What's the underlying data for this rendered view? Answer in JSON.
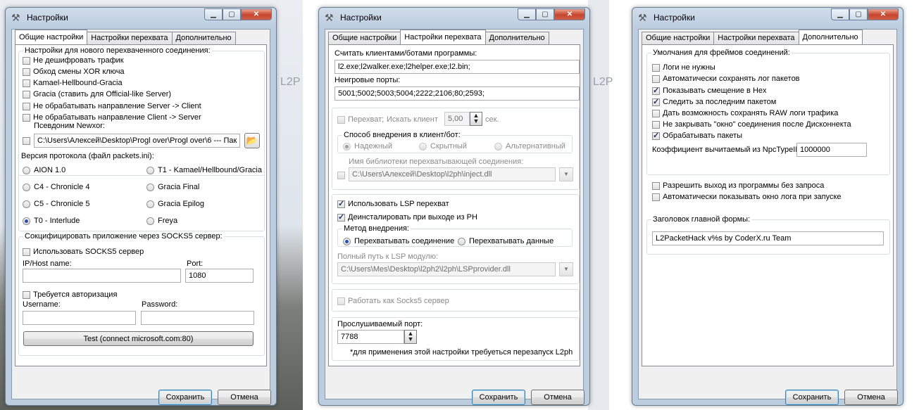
{
  "ghost_text": "L2P",
  "window_title": "Настройки",
  "tabs": [
    "Общие настройки",
    "Настройки перехвата",
    "Дополнительно"
  ],
  "buttons": {
    "save": "Сохранить",
    "cancel": "Отмена"
  },
  "general": {
    "new_conn_group": "Настройки для нового перехваченного соединения:",
    "checks": [
      {
        "label": "Не дешифровать трафик",
        "checked": false
      },
      {
        "label": "Обход смены XOR ключа",
        "checked": false
      },
      {
        "label": "Kamael-Hellbound-Gracia",
        "checked": false
      },
      {
        "label": "Gracia (ставить для Official-like Server)",
        "checked": false
      },
      {
        "label": "Не обрабатывать направление Server -> Client",
        "checked": false
      },
      {
        "label": "Не обрабатывать направление Client -> Server",
        "checked": false
      }
    ],
    "newxor_label": "Псевдоним Newxor:",
    "newxor_path": "C:\\Users\\Алексей\\Desktop\\Progl over\\Progl over\\6 --- Пак",
    "protocol_group": "Версия протокола (файл packets.ini):",
    "protocols": [
      {
        "label": "AION 1.0",
        "selected": false
      },
      {
        "label": "T1 - Kamael/Hellbound/Gracia",
        "selected": false
      },
      {
        "label": "C4 - Chronicle 4",
        "selected": false
      },
      {
        "label": "Gracia Final",
        "selected": false
      },
      {
        "label": "C5 - Chronicle 5",
        "selected": false
      },
      {
        "label": "Gracia Epilog",
        "selected": false
      },
      {
        "label": "T0 - Interlude",
        "selected": true
      },
      {
        "label": "Freya",
        "selected": false
      }
    ],
    "socks_group": "Сокцифицировать приложение через SOCKS5 сервер:",
    "use_socks": "Использовать SOCKS5 сервер",
    "ip_label": "IP/Host name:",
    "ip_value": "",
    "port_label": "Port:",
    "port_value": "1080",
    "auth": "Требуется авторизация",
    "username_label": "Username:",
    "password_label": "Password:",
    "test_button": "Test (connect microsoft.com:80)"
  },
  "intercept": {
    "clients_label": "Считать клиентами/ботами программы:",
    "clients_value": "l2.exe;l2walker.exe;l2helper.exe;l2.bin;",
    "ports_label": "Неигровые порты:",
    "ports_value": "5001;5002;5003;5004;2222;2106;80;2593;",
    "intercept_check": "Перехват;",
    "search_label": "Искать клиент",
    "search_value": "5,00",
    "sec_label": "сек.",
    "inject_group": "Способ внедрения в клиент/бот:",
    "inject_methods": [
      {
        "label": "Надежный",
        "selected": true
      },
      {
        "label": "Скрытный",
        "selected": false
      },
      {
        "label": "Альтернативный",
        "selected": false
      }
    ],
    "lib_label": "Имя библиотеки перехватывающей соединения:",
    "lib_value": "C:\\Users\\Алексей\\Desktop\\l2ph\\inject.dll",
    "use_lsp": "Использовать LSP перехват",
    "uninstall_lsp": "Деинсталировать при выходе из PH",
    "method_group": "Метод внедрения:",
    "methods": [
      {
        "label": "Перехватывать соединение",
        "selected": true
      },
      {
        "label": "Перехватывать данные",
        "selected": false
      }
    ],
    "lsp_path_label": "Полный путь к LSP модулю:",
    "lsp_path_value": "C:\\Users\\Mes\\Desktop\\l2ph2\\l2ph\\LSPprovider.dll",
    "socks5_server": "Работать как Socks5 сервер",
    "listen_label": "Прослушиваемый порт:",
    "listen_value": "7788",
    "restart_note": "*для применения этой настройки требуеться перезапуск L2ph"
  },
  "extra": {
    "frames_group": "Умолчания для фреймов соединений:",
    "checks": [
      {
        "label": "Логи не нужны",
        "checked": false
      },
      {
        "label": "Автоматически сохранять лог пакетов",
        "checked": false
      },
      {
        "label": "Показывать смещение в Hex",
        "checked": true
      },
      {
        "label": "Следить за последним пакетом",
        "checked": true
      },
      {
        "label": "Дать возможность сохранять RAW логи трафика",
        "checked": false
      },
      {
        "label": "Не закрывать \"окно\" соединения после Дисконнекта",
        "checked": false
      },
      {
        "label": "Обрабатывать пакеты",
        "checked": true
      }
    ],
    "npc_label": "Коэффициент вычитаемый из NpcTypeID",
    "npc_value": "1000000",
    "allow_exit": "Разрешить выход из программы без запроса",
    "auto_log": "Автоматически показывать окно лога при запуске",
    "caption_group": "Заголовок главной формы:",
    "caption_value": "L2PacketHack v%s by CoderX.ru Team"
  }
}
